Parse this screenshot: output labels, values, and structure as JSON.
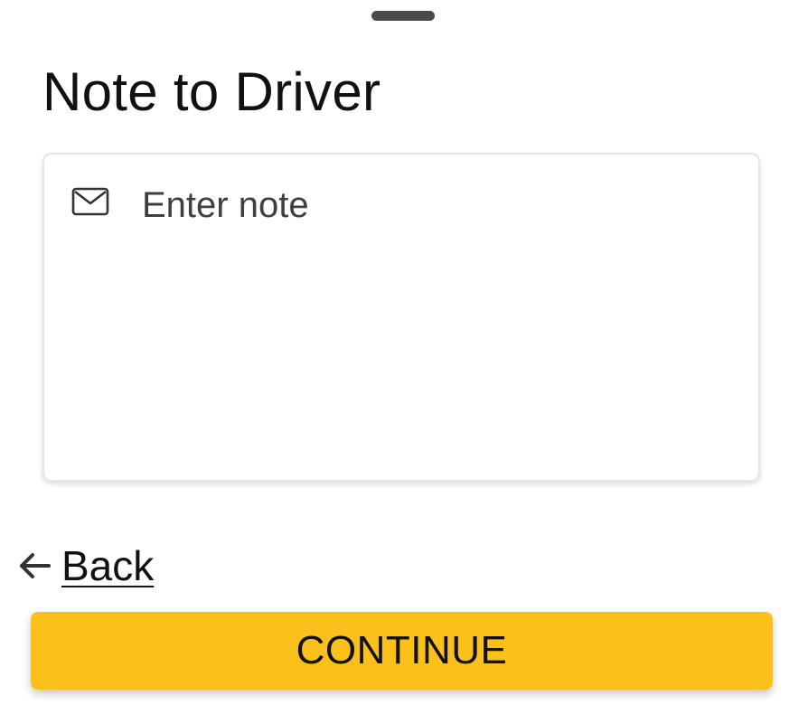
{
  "sheet": {
    "title": "Note to Driver"
  },
  "note": {
    "icon": "mail-icon",
    "placeholder": "Enter note",
    "value": ""
  },
  "navigation": {
    "back_icon": "arrow-left-icon",
    "back_label": "Back"
  },
  "actions": {
    "continue_label": "CONTINUE",
    "continue_color": "#fbc01b"
  }
}
